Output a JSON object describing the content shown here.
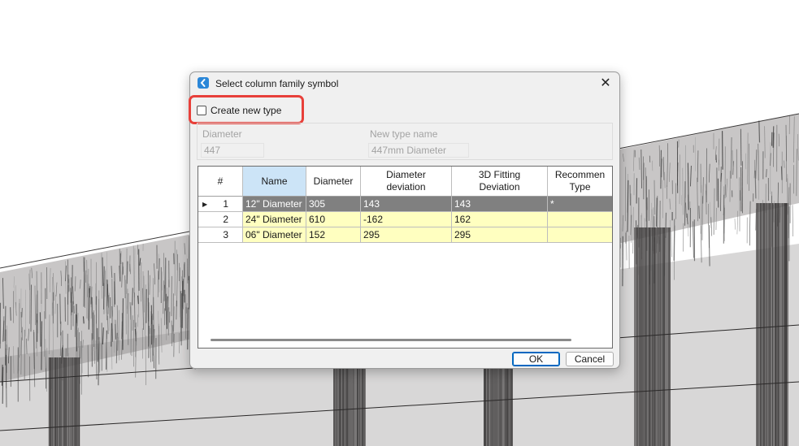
{
  "dialog": {
    "title": "Select column family symbol",
    "close_glyph": "✕",
    "create_new_type": {
      "label": "Create new type",
      "checked": false
    },
    "parameters": {
      "diameter_label": "Diameter",
      "diameter_value": "447",
      "new_type_name_label": "New type name",
      "new_type_name_value": "447mm Diameter"
    },
    "table": {
      "columns": [
        "#",
        "Name",
        "Diameter",
        "Diameter\ndeviation",
        "3D Fitting\nDeviation",
        "Recommen\nType"
      ],
      "rows": [
        {
          "num": "1",
          "name": "12\" Diameter",
          "diameter": "305",
          "deviation": "143",
          "fitting": "143",
          "recommended": "*",
          "selected": true
        },
        {
          "num": "2",
          "name": "24\" Diameter",
          "diameter": "610",
          "deviation": "-162",
          "fitting": "162",
          "recommended": "",
          "selected": false
        },
        {
          "num": "3",
          "name": "06\" Diameter",
          "diameter": "152",
          "deviation": "295",
          "fitting": "295",
          "recommended": "",
          "selected": false
        }
      ]
    },
    "buttons": {
      "ok": "OK",
      "cancel": "Cancel"
    }
  },
  "colors": {
    "highlight": "#e8403a",
    "selected_row": "#808080",
    "row_yellow": "#ffffc0",
    "header_selected": "#cce4f7",
    "accent": "#0067c0"
  },
  "icons": {
    "app": "app-logo-icon",
    "close": "close-icon",
    "row_pointer": "row-pointer-icon"
  }
}
